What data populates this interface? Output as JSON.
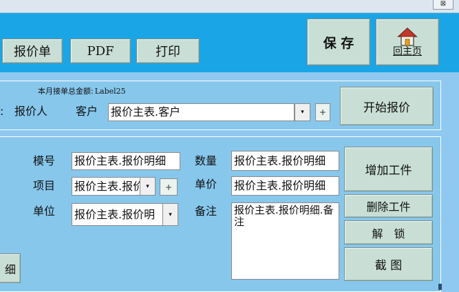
{
  "window": {
    "control_glyph": "⊠"
  },
  "toolbar": {
    "quote_label": "报价单",
    "pdf_label": "PDF",
    "print_label": "打印",
    "save_label": "保 存",
    "home_label": "回主页"
  },
  "summary": {
    "monthly_total_label": "本月接单总金额:",
    "monthly_total_value": "Label25",
    "quoter_prefix": ":",
    "quoter_label": "报价人",
    "customer_label": "客户",
    "customer_value": "报价主表.客户",
    "dropdown_glyph": "▾",
    "add_glyph": "+",
    "start_quote_label": "开始报价"
  },
  "detail": {
    "mold_no_label": "模号",
    "mold_no_value": "报价主表.报价明细",
    "item_label": "项目",
    "item_value": "报价主表.报价",
    "unit_label": "单位",
    "unit_value": "报价主表.报价明",
    "qty_label": "数量",
    "qty_value": "报价主表.报价明细",
    "price_label": "单价",
    "price_value": "报价主表.报价明细",
    "remark_label": "备注",
    "remark_value": "报价主表.报价明细.备注",
    "add_part_label": "增加工件",
    "delete_part_label": "删除工件",
    "unlock_label": "解　锁",
    "screenshot_label": "截 图",
    "partial_button_label": "细"
  }
}
